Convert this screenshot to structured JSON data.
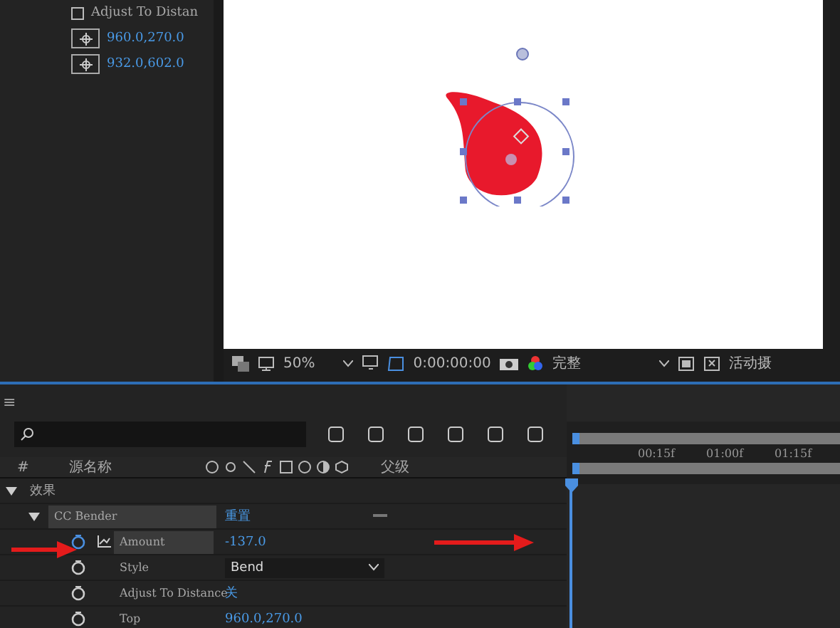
{
  "effect_controls": {
    "rows": [
      {
        "kind": "checkbox",
        "label": "Adjust To Distan",
        "checked": false
      },
      {
        "kind": "point",
        "value": "960.0,270.0"
      },
      {
        "kind": "point",
        "value": "932.0,602.0"
      }
    ]
  },
  "viewer": {
    "zoom": "50%",
    "timecode": "0:00:00:00",
    "resolution": "完整",
    "view": "活动摄"
  },
  "timeline": {
    "menu": "≡",
    "columns": [
      "#",
      "源名称",
      "父级"
    ],
    "ruler": [
      "00:15f",
      "01:00f",
      "01:15f"
    ],
    "groups": [
      {
        "name": "效果",
        "expanded": true,
        "children": [
          {
            "name": "CC Bender",
            "expanded": true,
            "reset": "重置",
            "properties": [
              {
                "kind": "keyframed",
                "name": "Amount",
                "value": "-137.0",
                "stopwatch_on": true,
                "selected": true
              },
              {
                "kind": "dropdown",
                "name": "Style",
                "value": "Bend",
                "stopwatch_on": false,
                "selected": false
              },
              {
                "kind": "text",
                "name": "Adjust To Distance",
                "value": "关",
                "stopwatch_on": false,
                "selected": false
              },
              {
                "kind": "text",
                "name": "Top",
                "value": "960.0,270.0",
                "stopwatch_on": false,
                "selected": false
              }
            ]
          }
        ]
      }
    ]
  }
}
